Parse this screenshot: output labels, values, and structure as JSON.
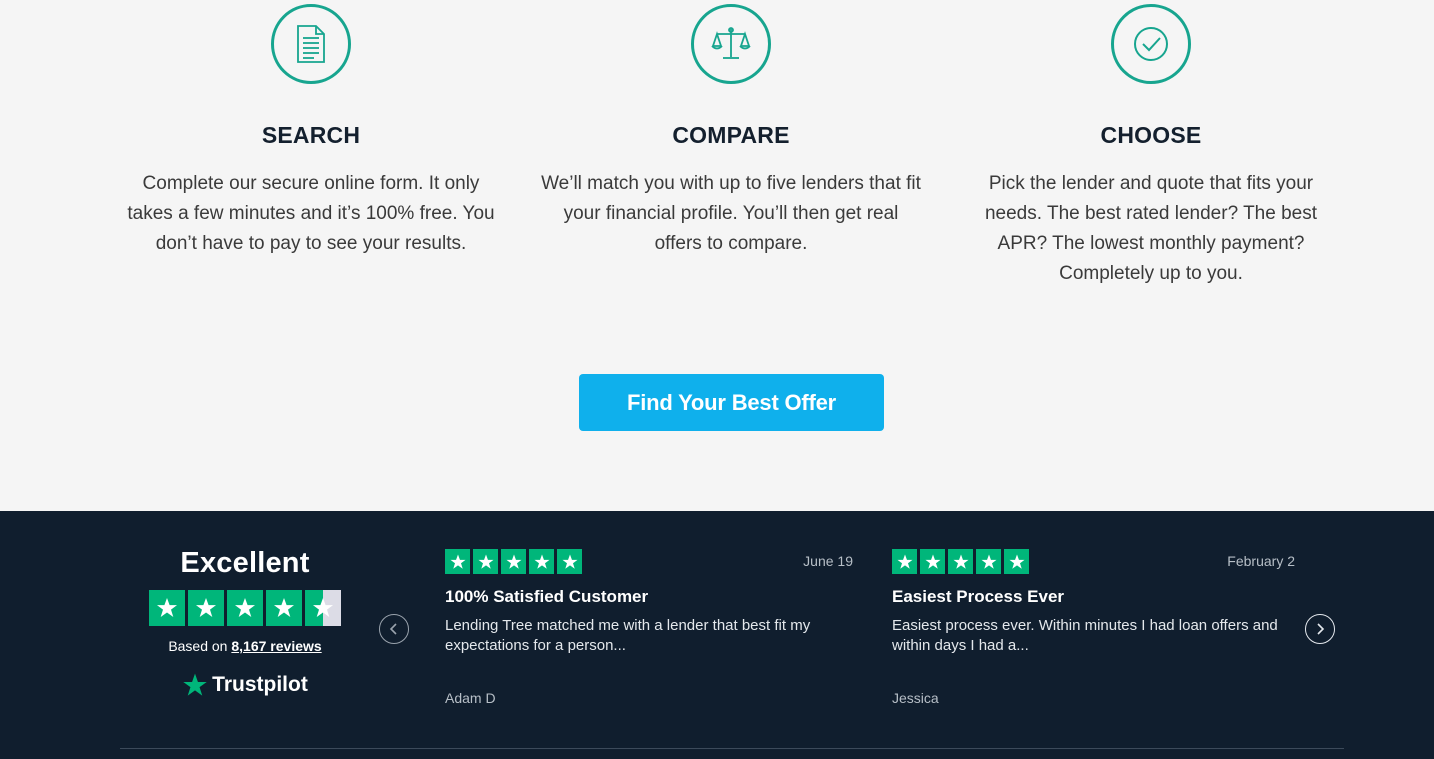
{
  "steps": [
    {
      "icon": "document-icon",
      "title": "SEARCH",
      "text": "Complete our secure online form. It only takes a few minutes and it’s 100% free. You don’t have to pay to see your results."
    },
    {
      "icon": "scales-icon",
      "title": "COMPARE",
      "text": "We’ll match you with up to five lenders that fit your financial profile. You’ll then get real offers to compare."
    },
    {
      "icon": "checkmark-circle-icon",
      "title": "CHOOSE",
      "text": "Pick the lender and quote that fits your needs. The best rated lender? The best APR? The lowest monthly payment? Completely up to you."
    }
  ],
  "cta": {
    "label": "Find Your Best Offer",
    "color": "#0fb0ec"
  },
  "trustpilot": {
    "rating_word": "Excellent",
    "stars": 4.5,
    "based_on_prefix": "Based on",
    "reviews_link": "8,167 reviews",
    "brand": "Trustpilot",
    "star_color": "#00b67a"
  },
  "reviews": [
    {
      "stars": 5,
      "date": "June 19",
      "title": "100% Satisfied Customer",
      "body": "Lending Tree matched me with a lender that best fit my expectations for a person...",
      "author": "Adam D"
    },
    {
      "stars": 5,
      "date": "February 2",
      "title": "Easiest Process Ever",
      "body": "Easiest process ever. Within minutes I had loan offers and within days I had a...",
      "author": "Jessica"
    }
  ],
  "colors": {
    "accent_teal": "#17a58f",
    "dark_bg": "#101e2e",
    "light_bg": "#f5f5f5"
  }
}
